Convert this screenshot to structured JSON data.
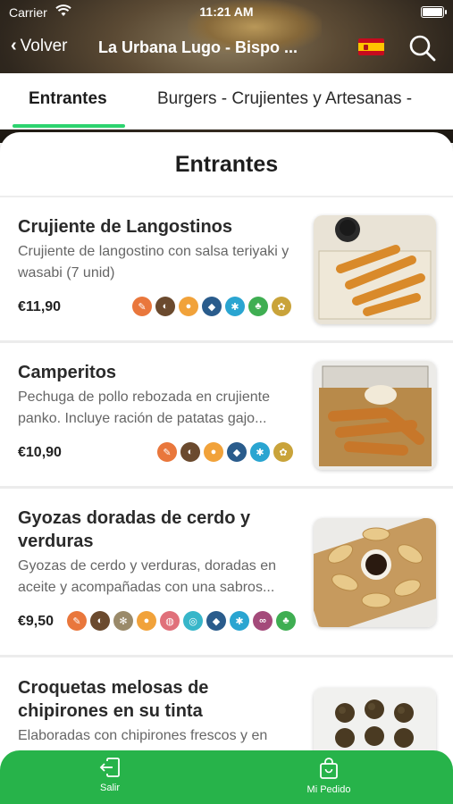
{
  "status_bar": {
    "carrier": "Carrier",
    "time": "11:21 AM"
  },
  "nav": {
    "back_label": "Volver",
    "title": "La Urbana Lugo - Bispo ...",
    "language_flag": "es"
  },
  "tabs": [
    {
      "label": "Entrantes",
      "active": true
    },
    {
      "label": "Burgers - Crujientes y Artesanas -",
      "active": false
    }
  ],
  "section": {
    "title": "Entrantes"
  },
  "items": [
    {
      "name": "Crujiente de Langostinos",
      "description": "Crujiente de langostino con salsa teriyaki y wasabi (7 unid)",
      "price": "€11,90",
      "allergens": [
        "gluten",
        "sesame",
        "egg",
        "fish",
        "crustacean",
        "celery",
        "mustard"
      ]
    },
    {
      "name": "Camperitos",
      "description": "Pechuga de pollo rebozada en crujiente panko. Incluye ración de patatas gajo...",
      "price": "€10,90",
      "allergens": [
        "gluten",
        "sesame",
        "egg",
        "fish",
        "crustacean",
        "mustard"
      ]
    },
    {
      "name": "Gyozas doradas de cerdo y verduras",
      "description": "Gyozas de cerdo y verduras, doradas en aceite y acompañadas con una sabros...",
      "price": "€9,50",
      "allergens": [
        "gluten",
        "sesame",
        "peanut",
        "egg",
        "soy",
        "mollusc",
        "fish",
        "crustacean",
        "lupin",
        "celery"
      ]
    },
    {
      "name": "Croquetas melosas de chipirones en su tinta",
      "description": "Elaboradas con chipirones frescos y en",
      "price": "",
      "allergens": []
    }
  ],
  "allergen_colors": {
    "gluten": "#e9773c",
    "sesame": "#6b4a2e",
    "peanut": "#9a8a6a",
    "egg": "#f1a23a",
    "soy": "#e0707a",
    "mollusc": "#37b6c9",
    "fish": "#2a5c8c",
    "crustacean": "#2aa5d1",
    "lupin": "#a44a7a",
    "celery": "#3fae52",
    "mustard": "#c9a33a"
  },
  "bottom_bar": {
    "exit_label": "Salir",
    "order_label": "Mi Pedido"
  },
  "colors": {
    "accent": "#2dd36f",
    "bottom_bar": "#27b34a"
  }
}
